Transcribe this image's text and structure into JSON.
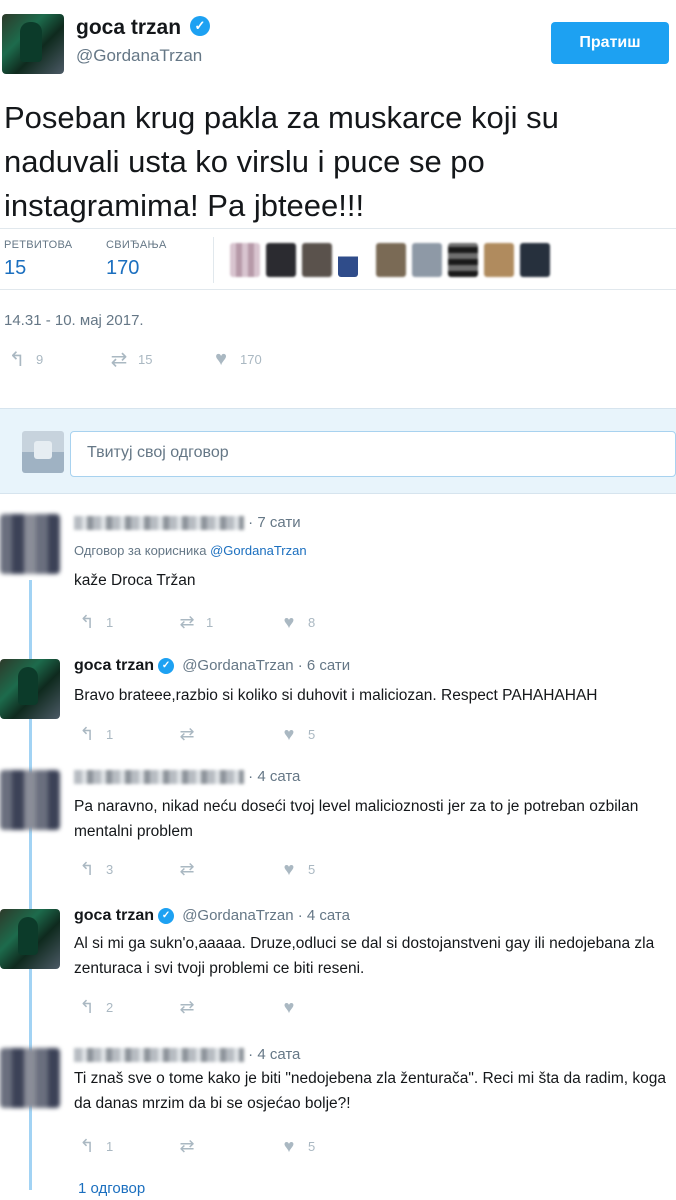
{
  "tweet": {
    "author_name": "goca trzan",
    "verified_icon": "✓",
    "author_handle": "@GordanaTrzan",
    "follow_label": "Пратиш",
    "text": "Poseban krug pakla za muskarce koji su naduvali usta ko virslu i puce se po instagramima! Pa jbteee!!!",
    "retweets_label": "РЕТВИТОВА",
    "retweets_count": "15",
    "likes_label": "СВИЂАЊА",
    "likes_count": "170",
    "timestamp": "14.31 - 10. мај 2017.",
    "reply_count": "9",
    "retweet_count_action": "15",
    "like_count_action": "170"
  },
  "compose": {
    "placeholder": "Твитуј свој одговор"
  },
  "replies": [
    {
      "time": "· 7 сати",
      "replying_prefix": "Одговор за корисника",
      "replying_to": "@GordanaTrzan",
      "text": "kaže Droca Tržan",
      "reply_count": "1",
      "retweet_count": "1",
      "like_count": "8"
    },
    {
      "name": "goca trzan",
      "handle": "@GordanaTrzan",
      "time": "· 6 сати",
      "text": "Bravo brateee,razbio si koliko si duhovit i maliciozan. Respect PAHAHAHAH",
      "reply_count": "1",
      "retweet_count": "",
      "like_count": "5"
    },
    {
      "time": "· 4 сата",
      "text": "Pa naravno, nikad neću doseći tvoj level malicioznosti jer za to je potreban ozbilan mentalni problem",
      "reply_count": "3",
      "retweet_count": "",
      "like_count": "5"
    },
    {
      "name": "goca trzan",
      "handle": "@GordanaTrzan",
      "time": "· 4 сата",
      "text": "Al si mi ga sukn'o,aaaaa. Druze,odluci se dal si dostojanstveni gay ili nedojebana zla zenturaca i svi tvoji problemi ce biti reseni.",
      "reply_count": "2",
      "retweet_count": "",
      "like_count": ""
    },
    {
      "time": "· 4 сата",
      "text": "Ti znaš sve o tome kako je biti \"nedojebena zla ženturača\". Reci mi šta da radim, koga da danas mrzim da bi se osjećao bolje?!",
      "reply_count": "1",
      "retweet_count": "",
      "like_count": "5"
    }
  ],
  "thread_more": "1 одговор",
  "icons": {
    "reply": "reply-icon",
    "retweet": "retweet-icon",
    "like": "heart-icon"
  },
  "colors": {
    "accent": "#1da1f2",
    "link": "#1b6fbf"
  }
}
